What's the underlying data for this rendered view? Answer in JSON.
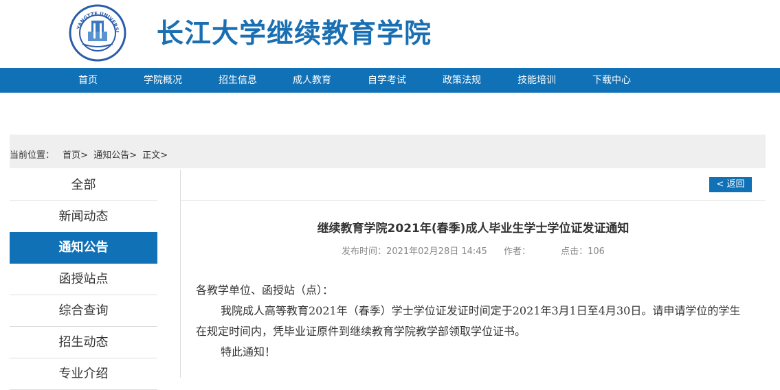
{
  "header": {
    "site_title": "长江大学继续教育学院",
    "logo_text": "YANGTZE UNIVERSITY"
  },
  "nav": {
    "items": [
      "首页",
      "学院概况",
      "招生信息",
      "成人教育",
      "自学考试",
      "政策法规",
      "技能培训",
      "下载中心"
    ]
  },
  "breadcrumb": {
    "prefix": "当前位置：",
    "items": [
      "首页>",
      "通知公告>",
      "正文>"
    ]
  },
  "sidebar": {
    "items": [
      "全部",
      "新闻动态",
      "通知公告",
      "函授站点",
      "综合查询",
      "招生动态",
      "专业介绍"
    ],
    "active": "通知公告"
  },
  "article": {
    "back_label": "< 返回",
    "title": "继续教育学院2021年(春季)成人毕业生学士学位证发证通知",
    "publish_label": "发布时间：",
    "publish_time": "2021年02月28日 14:45",
    "author_label": "作者：",
    "clicks_label": "点击：",
    "clicks": "106",
    "greeting": "各教学单位、函授站（点）：",
    "paragraph": "我院成人高等教育2021年（春季）学士学位证发证时间定于2021年3月1日至4月30日。请申请学位的学生在规定时间内，凭毕业证原件到继续教育学院教学部领取学位证书。",
    "closing": "特此通知！"
  },
  "colors": {
    "brand_blue": "#1171b6",
    "title_blue": "#1a6fb3",
    "crumb_bg": "#efefef"
  }
}
